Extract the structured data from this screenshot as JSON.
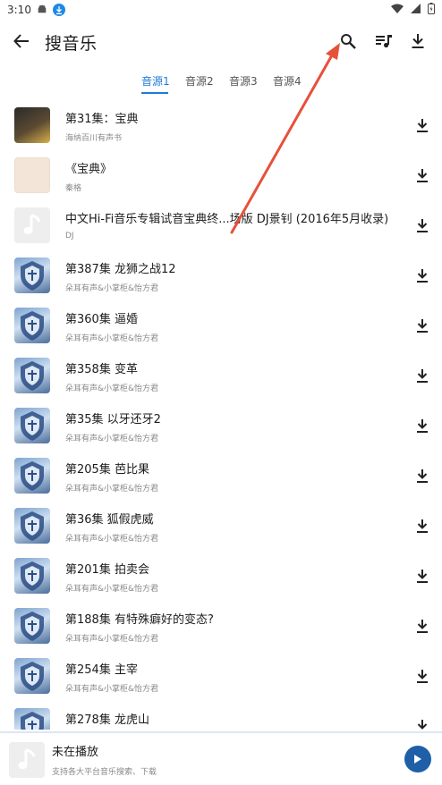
{
  "status_bar": {
    "time": "3:10"
  },
  "app_bar": {
    "title": "搜音乐"
  },
  "tabs": [
    {
      "label": "音源1",
      "active": true
    },
    {
      "label": "音源2",
      "active": false
    },
    {
      "label": "音源3",
      "active": false
    },
    {
      "label": "音源4",
      "active": false
    }
  ],
  "results": [
    {
      "title": "第31集：宝典",
      "subtitle": "海纳百川有声书",
      "cover": "dark"
    },
    {
      "title": "《宝典》",
      "subtitle": "秦格",
      "cover": "red"
    },
    {
      "title": "中文Hi-Fi音乐专辑试音宝典终...场版 DJ景钊 (2016年5月收录)",
      "subtitle": "DJ",
      "cover": "blank"
    },
    {
      "title": "第387集 龙狮之战12",
      "subtitle": "朵耳有声&小掌柜&怡方君",
      "cover": "shield"
    },
    {
      "title": "第360集 逼婚",
      "subtitle": "朵耳有声&小掌柜&怡方君",
      "cover": "shield"
    },
    {
      "title": "第358集 变革",
      "subtitle": "朵耳有声&小掌柜&怡方君",
      "cover": "shield"
    },
    {
      "title": "第35集 以牙还牙2",
      "subtitle": "朵耳有声&小掌柜&怡方君",
      "cover": "shield"
    },
    {
      "title": "第205集 芭比果",
      "subtitle": "朵耳有声&小掌柜&怡方君",
      "cover": "shield"
    },
    {
      "title": "第36集 狐假虎威",
      "subtitle": "朵耳有声&小掌柜&怡方君",
      "cover": "shield"
    },
    {
      "title": "第201集 拍卖会",
      "subtitle": "朵耳有声&小掌柜&怡方君",
      "cover": "shield"
    },
    {
      "title": "第188集 有特殊癖好的变态?",
      "subtitle": "朵耳有声&小掌柜&怡方君",
      "cover": "shield"
    },
    {
      "title": "第254集 主宰",
      "subtitle": "朵耳有声&小掌柜&怡方君",
      "cover": "shield"
    },
    {
      "title": "第278集  龙虎山",
      "subtitle": "",
      "cover": "shield"
    }
  ],
  "player": {
    "title": "未在播放",
    "subtitle": "支持各大平台音乐搜索、下载"
  },
  "colors": {
    "accent": "#1e7bd8",
    "play_button": "#1e5fa8",
    "annotation": "#e8503a"
  },
  "icons": [
    "back-arrow-icon",
    "search-icon",
    "queue-music-icon",
    "download-icon",
    "music-note-icon",
    "play-icon"
  ]
}
